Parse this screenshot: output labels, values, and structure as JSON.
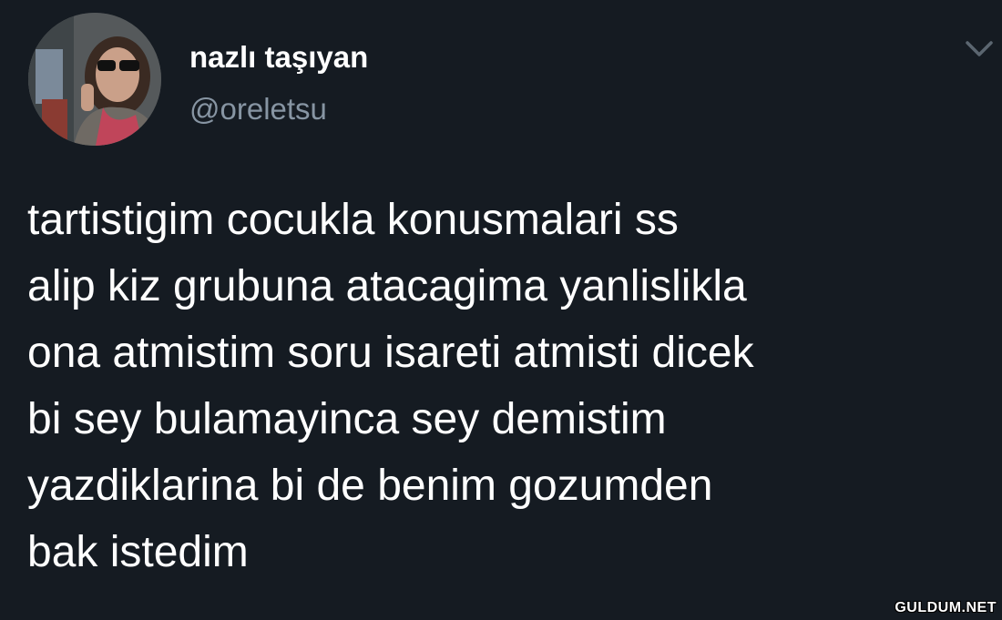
{
  "tweet": {
    "display_name": "nazlı taşıyan",
    "handle": "@oreletsu",
    "text": "tartistigim cocukla konusmalari ss\nalip kiz grubuna atacagima yanlislikla\nona atmistim soru isareti atmisti dicek\nbi sey bulamayinca sey demistim\nyazdiklarina bi de benim gozumden\nbak istedim",
    "menu_icon": "chevron-down-icon"
  },
  "watermark": {
    "text": "GULDUM.NET"
  },
  "colors": {
    "background": "#151b22",
    "text": "#ffffff",
    "handle": "#8795a3",
    "chevron": "#5b6670"
  }
}
